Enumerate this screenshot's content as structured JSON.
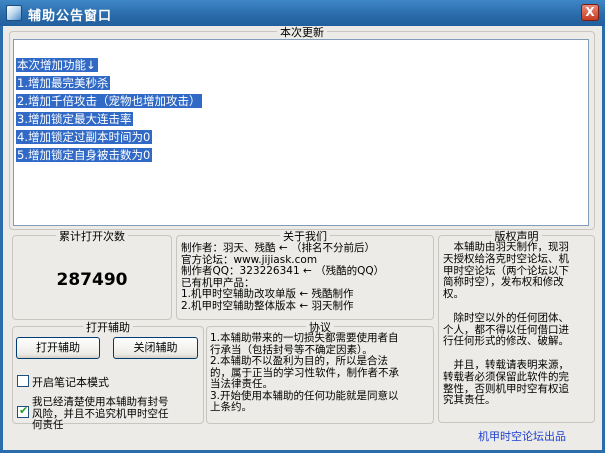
{
  "window": {
    "title": "辅助公告窗口",
    "close_glyph": "X"
  },
  "update_panel": {
    "title": "本次更新",
    "lines": [
      "本次增加功能↓",
      "1.增加最完美秒杀",
      "2.增加千倍攻击（宠物也增加攻击）",
      "3.增加锁定最大连击率",
      "4.增加锁定过副本时间为0",
      "5.增加锁定自身被击数为0"
    ]
  },
  "open_count": {
    "title": "累计打开次数",
    "value": "287490"
  },
  "about": {
    "title": "关于我们",
    "lines": [
      "制作者：羽天、残酷 ← （排名不分前后）",
      "官方论坛：www.jijiask.com",
      "制作者QQ：323226341 ← （残酷的QQ）",
      "已有机甲产品：",
      "1.机甲时空辅助改攻单版 ← 残酷制作",
      "2.机甲时空辅助整体版本 ← 羽天制作"
    ]
  },
  "copyright": {
    "title": "版权声明",
    "lines": [
      "　本辅助由羽天制作，现羽",
      "天授权给洛克时空论坛、机",
      "甲时空论坛（两个论坛以下",
      "简称时空），发布权和修改",
      "权。",
      "",
      "　除时空以外的任何团体、",
      "个人，都不得以任何借口进",
      "行任何形式的修改、破解。",
      "",
      "　并且，转载请表明来源，",
      "转载者必须保留此软件的完",
      "整性，否则机甲时空有权追",
      "究其责任。"
    ]
  },
  "open_panel": {
    "title": "打开辅助",
    "open_button": "打开辅助",
    "close_button": "关闭辅助",
    "notebook_mode_label": "开启笔记本模式",
    "risk_agree_lines": [
      "我已经清楚使用本辅助有封号",
      "风险，并且不追究机甲时空任",
      "何责任"
    ],
    "notebook_checked": false,
    "risk_checked": true
  },
  "agreement": {
    "title": "协议",
    "lines": [
      "1.本辅助带来的一切损失都需要使用者自",
      "行承当（包括封号等不确定因素）。",
      "2.本辅助不以盈利为目的，所以是合法",
      "的，属于正当的学习性软件，制作者不承",
      "当法律责任。",
      "3.开始使用本辅助的任何功能就是同意以",
      "上条约。"
    ]
  },
  "footer": {
    "credit": "机甲时空论坛出品"
  },
  "colors": {
    "title_bar": "#2b6cab",
    "selection": "#3169c6",
    "credit": "#1e3fd0"
  }
}
